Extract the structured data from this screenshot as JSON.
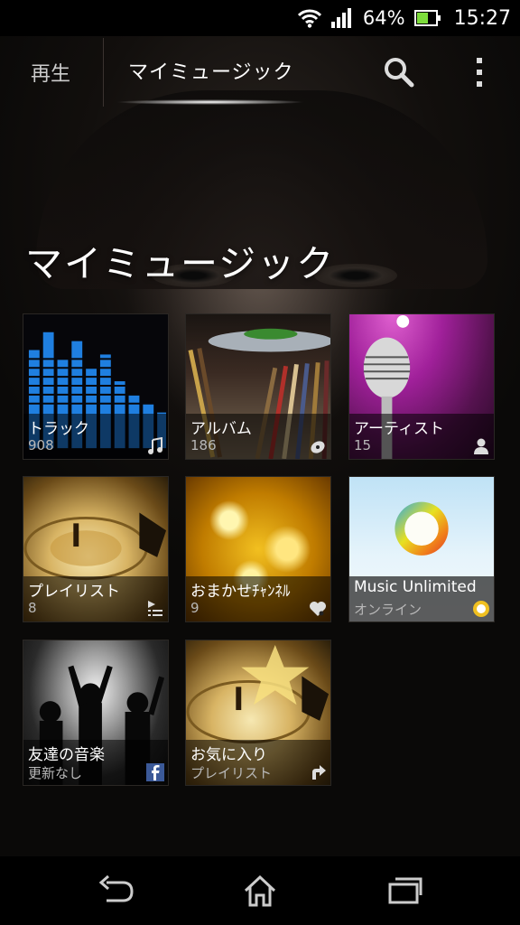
{
  "status_bar": {
    "battery_percent": "64%",
    "time": "15:27",
    "battery_level": 0.64,
    "icons": [
      "wifi-icon",
      "signal-icon",
      "battery-icon"
    ]
  },
  "tabs": {
    "play": "再生",
    "my_music": "マイミュージック"
  },
  "header": {
    "title": "マイミュージック",
    "actions": [
      "search-icon",
      "overflow-menu-icon"
    ]
  },
  "tiles": [
    {
      "label": "トラック",
      "sub": "908",
      "icon": "music-note-icon"
    },
    {
      "label": "アルバム",
      "sub": "186",
      "icon": "disc-icon"
    },
    {
      "label": "アーティスト",
      "sub": "15",
      "icon": "person-icon"
    },
    {
      "label": "プレイリスト",
      "sub": "8",
      "icon": "playlist-icon"
    },
    {
      "label": "おまかせﾁｬﾝﾈﾙ",
      "sub": "9",
      "icon": "heart-music-icon"
    },
    {
      "label": "Music Unlimited",
      "sub": "オンライン",
      "icon": "music-unlimited-icon"
    },
    {
      "label": "友達の音楽",
      "sub": "更新なし",
      "icon": "facebook-icon"
    },
    {
      "label": "お気に入り",
      "sub": "プレイリスト",
      "icon": "shortcut-arrow-icon"
    }
  ],
  "nav": [
    "back-icon",
    "home-icon",
    "recent-apps-icon"
  ],
  "colors": {
    "battery": "#7ddc3c",
    "facebook": "#3b5998"
  }
}
